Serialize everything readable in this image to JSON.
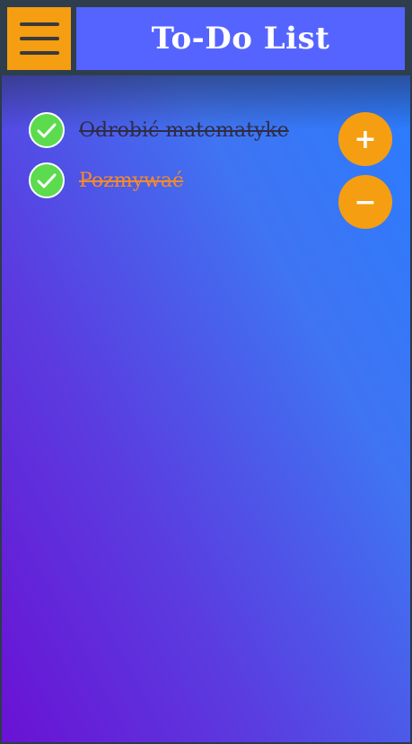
{
  "header": {
    "title": "To-Do List",
    "menu_icon": "hamburger-menu-icon"
  },
  "tasks": [
    {
      "text": "Odrobić matematyke",
      "done": true
    },
    {
      "text": "Pozmywać",
      "done": true
    }
  ],
  "actions": {
    "add_label": "+",
    "remove_label": "−"
  },
  "colors": {
    "accent": "#f59e12",
    "title_bar": "#5664ff",
    "check": "#5cdb4e",
    "task2_text": "#f28a2e"
  }
}
